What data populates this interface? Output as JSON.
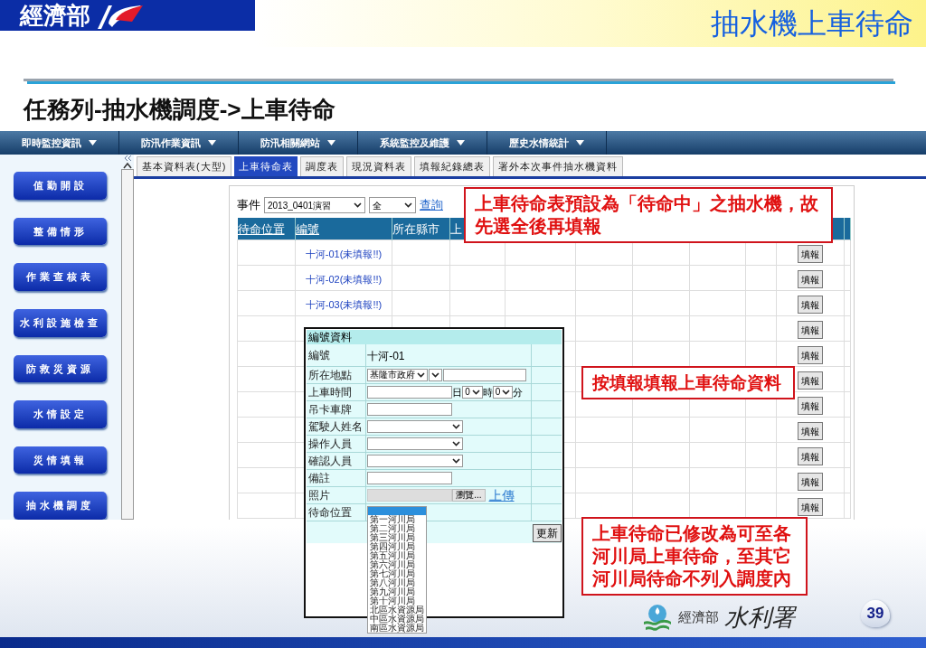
{
  "slide": {
    "brand": "經濟部",
    "title": "抽水機上車待命",
    "subtitle": "任務列-抽水機調度->上車待命",
    "footer_org_small": "經濟部",
    "footer_org_large": "水利署",
    "page": "39"
  },
  "menu": [
    "即時監控資訊",
    "防汛作業資訊",
    "防汛相關網站",
    "系統監控及維護",
    "歷史水情統計"
  ],
  "sidebar": [
    "值勤開設",
    "整備情形",
    "作業查核表",
    "水利設施檢查",
    "防救災資源",
    "水情設定",
    "災情填報",
    "抽水機調度"
  ],
  "tabs": [
    {
      "label": "基本資料表(大型)",
      "selected": false
    },
    {
      "label": "上車待命表",
      "selected": true
    },
    {
      "label": "調度表",
      "selected": false
    },
    {
      "label": "現況資料表",
      "selected": false
    },
    {
      "label": "填報紀錄總表",
      "selected": false
    },
    {
      "label": "署外本次事件抽水機資料",
      "selected": false
    }
  ],
  "filter": {
    "label": "事件",
    "event": "2013_0401演習",
    "scope": "全",
    "query": "查詢"
  },
  "table": {
    "columns": [
      "待命位置",
      "編號",
      "所在縣市",
      "上"
    ],
    "rows": [
      {
        "id": "十河-01(未填報!!)",
        "action": "填報"
      },
      {
        "id": "十河-02(未填報!!)",
        "action": "填報"
      },
      {
        "id": "十河-03(未填報!!)",
        "action": "填報"
      },
      {
        "action": "填報"
      },
      {
        "action": "填報"
      },
      {
        "action": "填報"
      },
      {
        "action": "填報"
      },
      {
        "action": "填報"
      },
      {
        "action": "填報"
      },
      {
        "action": "填報"
      },
      {
        "action": "填報"
      }
    ]
  },
  "form": {
    "title": "編號資料",
    "fields": [
      {
        "kind": "text",
        "label": "編號",
        "value": "十河-01"
      },
      {
        "kind": "location",
        "label": "所在地點",
        "value": "基隆市政府"
      },
      {
        "kind": "datetime",
        "label": "上車時間",
        "day_unit": "日",
        "hour": "0",
        "hour_unit": "時",
        "minute": "0",
        "minute_unit": "分"
      },
      {
        "kind": "input",
        "label": "吊卡車牌"
      },
      {
        "kind": "select",
        "label": "駕駛人姓名"
      },
      {
        "kind": "select",
        "label": "操作人員"
      },
      {
        "kind": "select",
        "label": "確認人員"
      },
      {
        "kind": "input",
        "label": "備註"
      },
      {
        "kind": "file",
        "label": "照片",
        "browse": "瀏覽...",
        "upload": "上傳"
      },
      {
        "kind": "dropdown",
        "label": "待命位置",
        "options": [
          "第一河川局",
          "第二河川局",
          "第三河川局",
          "第四河川局",
          "第五河川局",
          "第六河川局",
          "第七河川局",
          "第八河川局",
          "第九河川局",
          "第十河川局",
          "北區水資源局",
          "中區水資源局",
          "南區水資源局"
        ]
      }
    ],
    "submit": "更新"
  },
  "callouts": [
    "上車待命表預設為「待命中」之抽水機，故先選全後再填報",
    "按填報填報上車待命資料",
    "上車待命已修改為可至各河川局上車待命，至其它河川局待命不列入調度內"
  ]
}
